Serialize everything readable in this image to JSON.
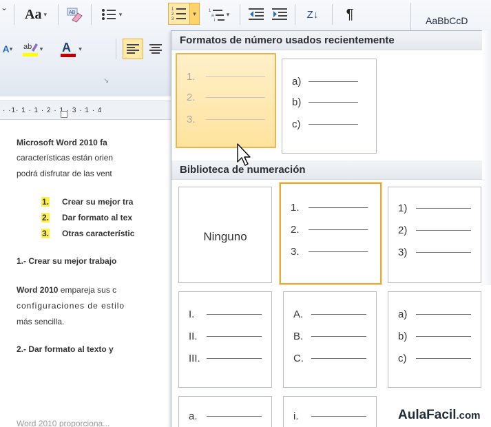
{
  "ribbon": {
    "font_size_label": "Aa",
    "show_marks_glyph": "¶",
    "sort_glyph": "Z↓",
    "styles_preview": "AaBbCcD",
    "launcher_glyph": "↘",
    "colors": {
      "highlight": "#ffff00",
      "font_color": "#c00000",
      "active": "#ffe9a8"
    }
  },
  "ruler": {
    "text": "· ·1· 1 · 1 · 2 · 1 · 3 · 1 · 4"
  },
  "document": {
    "lines": [
      {
        "text": "Microsoft Word 2010 fa",
        "bold": true
      },
      {
        "text": "características están orien"
      },
      {
        "text": "podrá disfrutar de las vent"
      }
    ],
    "list": [
      {
        "num": "1.",
        "text": "Crear su mejor tra"
      },
      {
        "num": "2.",
        "text": "Dar formato al tex"
      },
      {
        "num": "3.",
        "text": "Otras característic"
      }
    ],
    "section1_heading": "1.- Crear su mejor trabajo",
    "para2": {
      "lead": "Word 2010",
      "line1_rest": " empareja sus c",
      "line2": "configuraciones de estilo",
      "line3": "más sencilla."
    },
    "section2_heading": "2.- Dar formato al texto y",
    "cut_line": "Word 2010 proporciona..."
  },
  "gallery": {
    "recent_header": "Formatos de número usados recientemente",
    "library_header": "Biblioteca de numeración",
    "recent": [
      {
        "labels": [
          "1.",
          "2.",
          "3."
        ],
        "state": "hover"
      },
      {
        "labels": [
          "a)",
          "b)",
          "c)"
        ],
        "state": "normal"
      }
    ],
    "none_label": "Ninguno",
    "library": [
      {
        "labels": [
          "1.",
          "2.",
          "3."
        ],
        "state": "selected"
      },
      {
        "labels": [
          "1)",
          "2)",
          "3)"
        ],
        "state": "normal"
      },
      {
        "labels": [
          "I.",
          "II.",
          "III."
        ],
        "state": "normal"
      },
      {
        "labels": [
          "A.",
          "B.",
          "C."
        ],
        "state": "normal"
      },
      {
        "labels": [
          "a)",
          "b)",
          "c)"
        ],
        "state": "normal"
      },
      {
        "labels": [
          "a."
        ],
        "state": "normal"
      },
      {
        "labels": [
          "i."
        ],
        "state": "normal"
      }
    ]
  },
  "watermark": {
    "main": "AulaFacil",
    "suffix": ".com"
  }
}
